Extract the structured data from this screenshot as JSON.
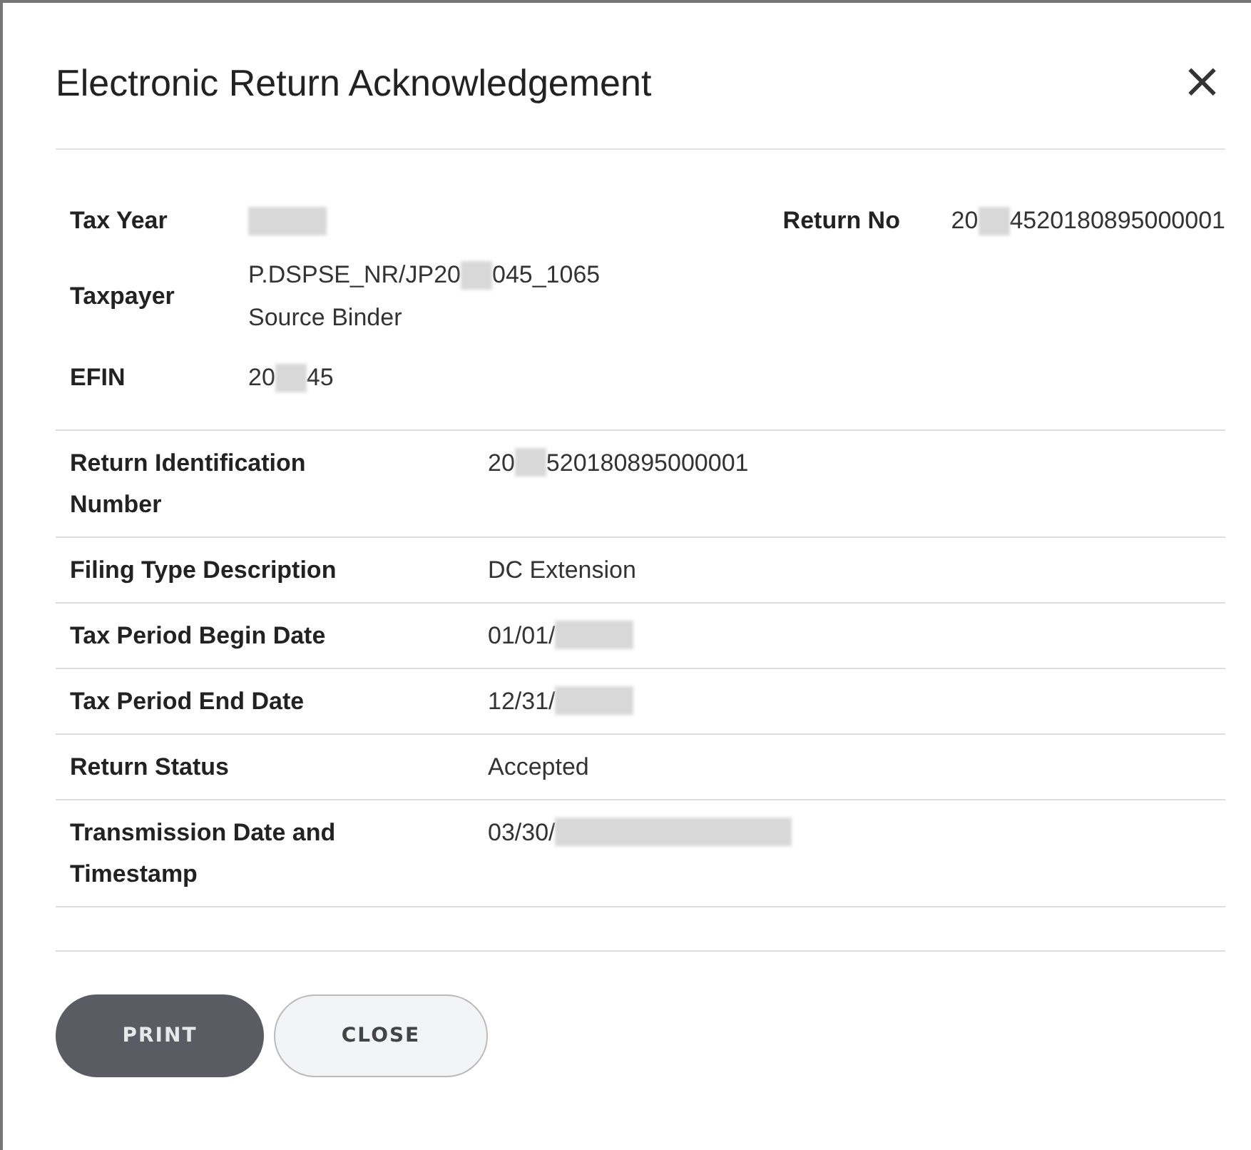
{
  "dialog": {
    "title": "Electronic Return Acknowledgement",
    "close_icon": "×"
  },
  "summary": {
    "tax_year": {
      "label": "Tax Year",
      "value": [
        {
          "kind": "blur"
        }
      ]
    },
    "return_no": {
      "label": "Return No",
      "value": [
        {
          "kind": "text",
          "text": "20"
        },
        {
          "kind": "gap"
        },
        {
          "kind": "text",
          "text": "4520180895000001"
        }
      ]
    },
    "taxpayer": {
      "label": "Taxpayer",
      "lines": [
        [
          {
            "kind": "text",
            "text": "P.DSPSE_NR/JP20"
          },
          {
            "kind": "gap"
          },
          {
            "kind": "text",
            "text": "045_1065"
          }
        ],
        [
          {
            "kind": "text",
            "text": "Source Binder"
          }
        ]
      ]
    },
    "efin": {
      "label": "EFIN",
      "value": [
        {
          "kind": "text",
          "text": "20"
        },
        {
          "kind": "gap"
        },
        {
          "kind": "text",
          "text": "45"
        }
      ]
    }
  },
  "details": [
    {
      "label": "Return Identification Number",
      "value": [
        {
          "kind": "text",
          "text": "20"
        },
        {
          "kind": "gap"
        },
        {
          "kind": "text",
          "text": "520180895000001"
        }
      ]
    },
    {
      "label": "Filing Type Description",
      "value": [
        {
          "kind": "text",
          "text": "DC Extension"
        }
      ]
    },
    {
      "label": "Tax Period Begin Date",
      "value": [
        {
          "kind": "text",
          "text": "01/01/"
        },
        {
          "kind": "blur"
        }
      ]
    },
    {
      "label": "Tax Period End Date",
      "value": [
        {
          "kind": "text",
          "text": "12/31/"
        },
        {
          "kind": "blur"
        }
      ]
    },
    {
      "label": "Return Status",
      "value": [
        {
          "kind": "text",
          "text": "Accepted"
        }
      ]
    },
    {
      "label": "Transmission Date and Timestamp",
      "value": [
        {
          "kind": "text",
          "text": "03/30/"
        },
        {
          "kind": "streak"
        }
      ]
    }
  ],
  "buttons": [
    {
      "label": "PRINT",
      "kind": "primary"
    },
    {
      "label": "CLOSE",
      "kind": "secondary"
    }
  ]
}
